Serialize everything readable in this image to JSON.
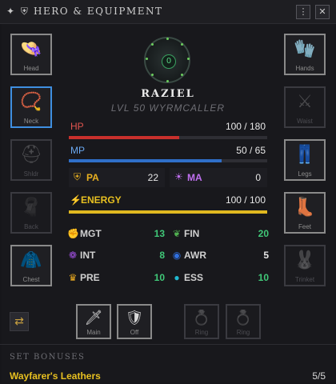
{
  "window": {
    "title": "HERO & EQUIPMENT",
    "menu_glyph": "⋮",
    "close_glyph": "✕",
    "title_icons": "✦ ⛨"
  },
  "character": {
    "name": "RAZIEL",
    "subtitle": "LVL 50 WYRMCALLER",
    "portrait_glyph": "0"
  },
  "equipment": {
    "left": [
      {
        "label": "Head",
        "icon": "👒",
        "icon_name": "hat-icon",
        "empty": false
      },
      {
        "label": "Neck",
        "icon": "📿",
        "icon_name": "necklace-icon",
        "empty": false
      },
      {
        "label": "Shldr",
        "icon": "⛑",
        "icon_name": "shoulder-icon",
        "empty": true
      },
      {
        "label": "Back",
        "icon": "🧣",
        "icon_name": "cloak-icon",
        "empty": true
      },
      {
        "label": "Chest",
        "icon": "🧥",
        "icon_name": "coat-icon",
        "empty": false
      }
    ],
    "right": [
      {
        "label": "Hands",
        "icon": "🧤",
        "icon_name": "gloves-icon",
        "empty": false
      },
      {
        "label": "Waist",
        "icon": "⚔",
        "icon_name": "belt-icon",
        "empty": true
      },
      {
        "label": "Legs",
        "icon": "👖",
        "icon_name": "trousers-icon",
        "empty": false
      },
      {
        "label": "Feet",
        "icon": "👢",
        "icon_name": "boots-icon",
        "empty": false
      },
      {
        "label": "Trinket",
        "icon": "🐰",
        "icon_name": "trinket-icon",
        "empty": true
      }
    ],
    "bottom": [
      {
        "label": "Main",
        "icon": "🗡",
        "icon_name": "sword-icon",
        "empty": false
      },
      {
        "label": "Off",
        "icon": "🛡",
        "icon_name": "shield-icon",
        "empty": false
      },
      {
        "label": "Ring",
        "icon": "💍",
        "icon_name": "ring-icon",
        "empty": true
      },
      {
        "label": "Ring",
        "icon": "💍",
        "icon_name": "ring-icon",
        "empty": true
      }
    ],
    "selected_slot": "Neck",
    "swap_glyph": "⇄"
  },
  "bars": {
    "hp": {
      "label": "HP",
      "text": "100 / 180",
      "current": 100,
      "max": 180,
      "color": "#c8302c",
      "label_color": "#e0554f"
    },
    "mp": {
      "label": "MP",
      "text": "50 / 65",
      "current": 50,
      "max": 65,
      "color": "#2f6fc8",
      "label_color": "#6aa8f0"
    },
    "energy": {
      "label": "ENERGY",
      "text": "100 / 100",
      "current": 100,
      "max": 100,
      "color": "#e0b820",
      "label_color": "#e8c020",
      "icon": "⚡"
    }
  },
  "combat": {
    "pa": {
      "label": "PA",
      "value": "22",
      "icon": "⛨",
      "color": "#e8b020"
    },
    "ma": {
      "label": "MA",
      "value": "0",
      "icon": "☀",
      "color": "#c070f0"
    }
  },
  "attributes": [
    {
      "label": "MGT",
      "value": "13",
      "icon": "✊",
      "icon_color": "#e04040",
      "value_color": "#40c878"
    },
    {
      "label": "FIN",
      "value": "20",
      "icon": "❦",
      "icon_color": "#50b050",
      "value_color": "#40c878"
    },
    {
      "label": "INT",
      "value": "8",
      "icon": "❁",
      "icon_color": "#a050e0",
      "value_color": "#40c878"
    },
    {
      "label": "AWR",
      "value": "5",
      "icon": "◉",
      "icon_color": "#3070e0",
      "value_color": "#e6e6e6"
    },
    {
      "label": "PRE",
      "value": "10",
      "icon": "♛",
      "icon_color": "#e8a820",
      "value_color": "#40c878"
    },
    {
      "label": "ESS",
      "value": "10",
      "icon": "●",
      "icon_color": "#20b8d0",
      "value_color": "#40c878"
    }
  ],
  "set_bonuses": {
    "title": "SET BONUSES",
    "name": "Wayfarer's Leathers",
    "count": "5/5"
  }
}
